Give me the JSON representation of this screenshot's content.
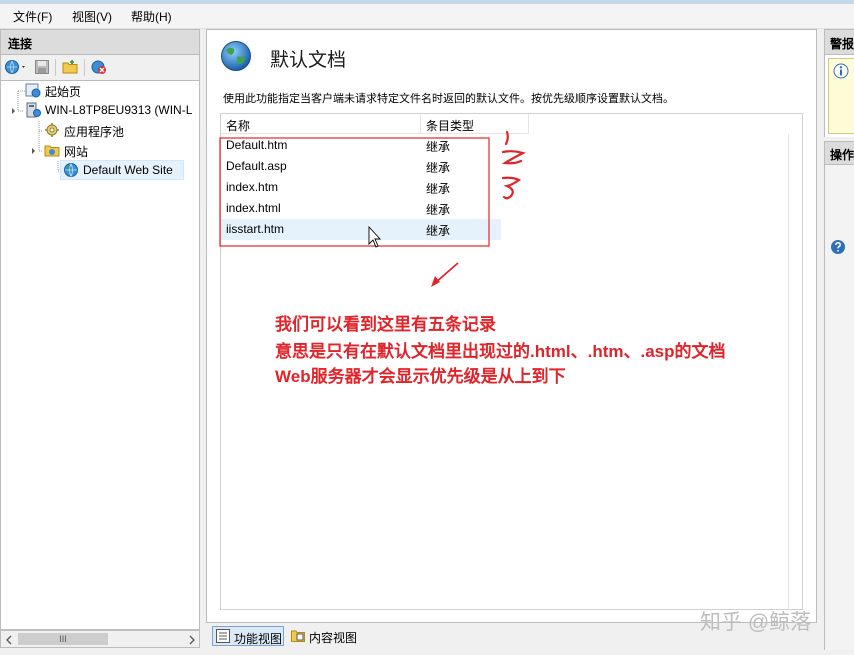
{
  "menubar": {
    "items": [
      {
        "label": "文件(F)"
      },
      {
        "label": "视图(V)"
      },
      {
        "label": "帮助(H)"
      }
    ]
  },
  "connections": {
    "title": "连接",
    "tree": [
      {
        "label": "起始页",
        "icon": "start-page-icon"
      },
      {
        "label": "WIN-L8TP8EU9313 (WIN-L",
        "icon": "server-icon"
      },
      {
        "label": "应用程序池",
        "icon": "app-pool-icon"
      },
      {
        "label": "网站",
        "icon": "sites-folder-icon"
      },
      {
        "label": "Default Web Site",
        "icon": "globe-icon"
      }
    ],
    "scroll_thumb": "III"
  },
  "main": {
    "title": "默认文档",
    "description": "使用此功能指定当客户端未请求特定文件名时返回的默认文件。按优先级顺序设置默认文档。",
    "columns": [
      "名称",
      "条目类型"
    ],
    "rows": [
      {
        "name": "Default.htm",
        "type": "继承"
      },
      {
        "name": "Default.asp",
        "type": "继承"
      },
      {
        "name": "index.htm",
        "type": "继承"
      },
      {
        "name": "index.html",
        "type": "继承"
      },
      {
        "name": "iisstart.htm",
        "type": "继承"
      }
    ]
  },
  "bottom_tabs": {
    "features_view": "功能视图",
    "content_view": "内容视图"
  },
  "right_panel": {
    "alerts_title": "警报",
    "actions_title": "操作"
  },
  "annotation": {
    "line1": "我们可以看到这里有五条记录",
    "line2": "意思是只有在默认文档里出现过的.html、.htm、.asp的文档",
    "line3": "Web服务器才会显示优先级是从上到下",
    "numbers": [
      "1",
      "2",
      "3"
    ],
    "color": "#e0242a"
  },
  "watermark": "知乎 @鲸落"
}
